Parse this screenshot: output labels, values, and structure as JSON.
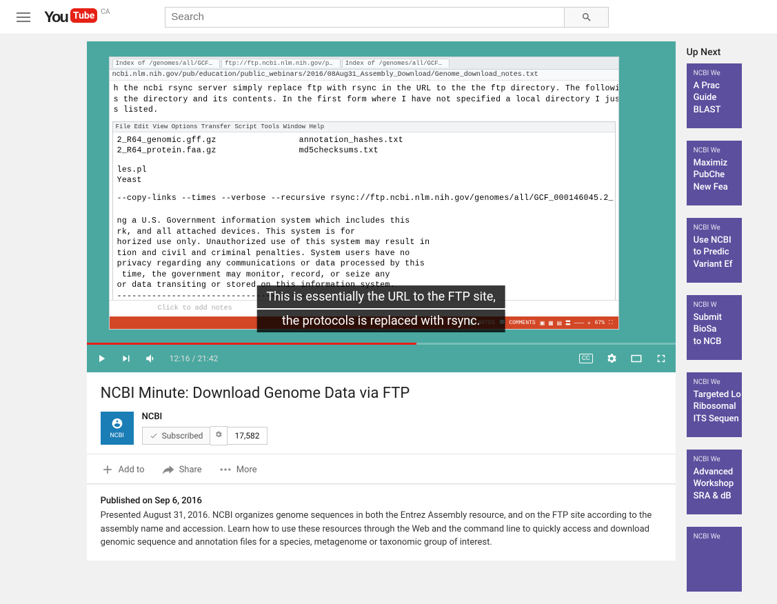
{
  "header": {
    "logo_text": "You",
    "logo_tube": "Tube",
    "country": "CA",
    "search_placeholder": "Search"
  },
  "player": {
    "caption_line1": "This is essentially the URL to the FTP site,",
    "caption_line2": "the protocols is replaced with rsync.",
    "time_current": "12:16",
    "time_total": "21:42",
    "progress_pct": 56,
    "content": {
      "tab1": "Index of /genomes/all/GCF…",
      "tab2": "ftp://ftp.ncbi.nlm.nih.gov/p…",
      "tab3": "Index of /genomes/all/GCF…",
      "url": "ncbi.nlm.nih.gov/pub/education/public_webinars/2016/08Aug31_Assembly_Download/Genome_download_notes.txt",
      "body1a": "h the ncbi rsync server simply replace ftp with rsync in the URL to the the ftp directory. The following",
      "body1b": "s the directory and its contents. In the first form where I have not specified a local directory I just",
      "body1c": "s listed.",
      "menu": "File  Edit  View  Options  Transfer  Script  Tools  Window  Help",
      "col1a": "2_R64_genomic.gff.gz",
      "col1b": "2_R64_protein.faa.gz",
      "col2a": "annotation_hashes.txt",
      "col2b": "md5checksums.txt",
      "line_les": "les.pl",
      "line_yeast": "Yeast",
      "rsync": "--copy-links --times --verbose --recursive rsync://ftp.ncbi.nlm.nih.gov/genomes/all/GCF_000146045.2_",
      "gov1": "ng a U.S. Government information system which includes this",
      "gov2": "rk, and all attached devices. This system is for",
      "gov3": "horized use only. Unauthorized use of this system may result in",
      "gov4": "tion and civil and criminal penalties. System users have no",
      "gov5": "privacy regarding any communications or data processed by this",
      "gov6": " time, the government may monitor, record, or seize any",
      "gov7": "or data transiting or stored on this information system.",
      "notes_placeholder": "Click to add notes",
      "ppt_zoom": "67%",
      "ppt_notes": "NOTES",
      "ppt_comments": "COMMENTS"
    }
  },
  "video": {
    "title": "NCBI Minute: Download Genome Data via FTP",
    "channel": "NCBI",
    "channel_short": "NCBI",
    "subscribe_state": "Subscribed",
    "sub_count": "17,582",
    "addto": "Add to",
    "share": "Share",
    "more": "More",
    "published_label": "Published on ",
    "published_date": "Sep 6, 2016",
    "description": "Presented August 31, 2016. NCBI organizes genome sequences in both the Entrez Assembly resource, and on the FTP site according to the assembly name and accession. Learn how to use these resources through the Web and the command line to quickly access and download genomic sequence and annotation files for a species, metagenome or taxonomic group of interest."
  },
  "sidebar": {
    "upnext": "Up Next",
    "items": [
      {
        "src": "NCBI We",
        "title": "A Prac\nGuide\nBLAST"
      },
      {
        "src": "NCBI We",
        "title": "Maximiz\nPubChe\nNew Fea"
      },
      {
        "src": "NCBI We",
        "title": "Use NCBI\nto Predic\nVariant Ef"
      },
      {
        "src": "NCBI W",
        "title": "Submit\nBioSa\nto NCB"
      },
      {
        "src": "NCBI We",
        "title": "Targeted Lo\nRibosomal\nITS Sequen"
      },
      {
        "src": "NCBI We",
        "title": "Advanced\nWorkshop\nSRA & dB"
      },
      {
        "src": "NCBI We",
        "title": ""
      }
    ]
  }
}
